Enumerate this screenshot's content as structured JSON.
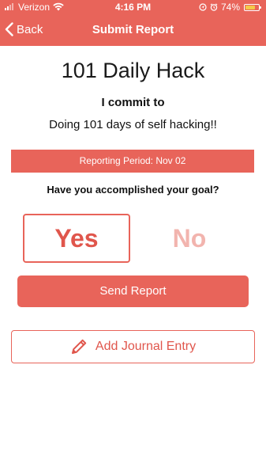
{
  "status_bar": {
    "carrier": "Verizon",
    "time": "4:16 PM",
    "battery_percent": "74%",
    "battery_level": 0.74,
    "icons": [
      "signal-icon",
      "wifi-icon",
      "location-icon",
      "alarm-icon",
      "battery-icon"
    ]
  },
  "nav": {
    "back_label": "Back",
    "title": "Submit Report",
    "back_icon": "chevron-left-icon"
  },
  "report": {
    "app_title": "101 Daily Hack",
    "commit_heading": "I commit to",
    "commit_text": "Doing 101 days of self hacking!!",
    "period": "Reporting Period: Nov 02",
    "question": "Have you accomplished your goal?",
    "yes_label": "Yes",
    "no_label": "No",
    "selected": "Yes",
    "send_label": "Send Report",
    "journal_label": "Add Journal Entry",
    "journal_icon": "pencil-icon"
  },
  "colors": {
    "accent": "#e8645a",
    "accent_text": "#e0564c",
    "inactive": "#f2b4ae",
    "battery": "#f3c94a"
  }
}
